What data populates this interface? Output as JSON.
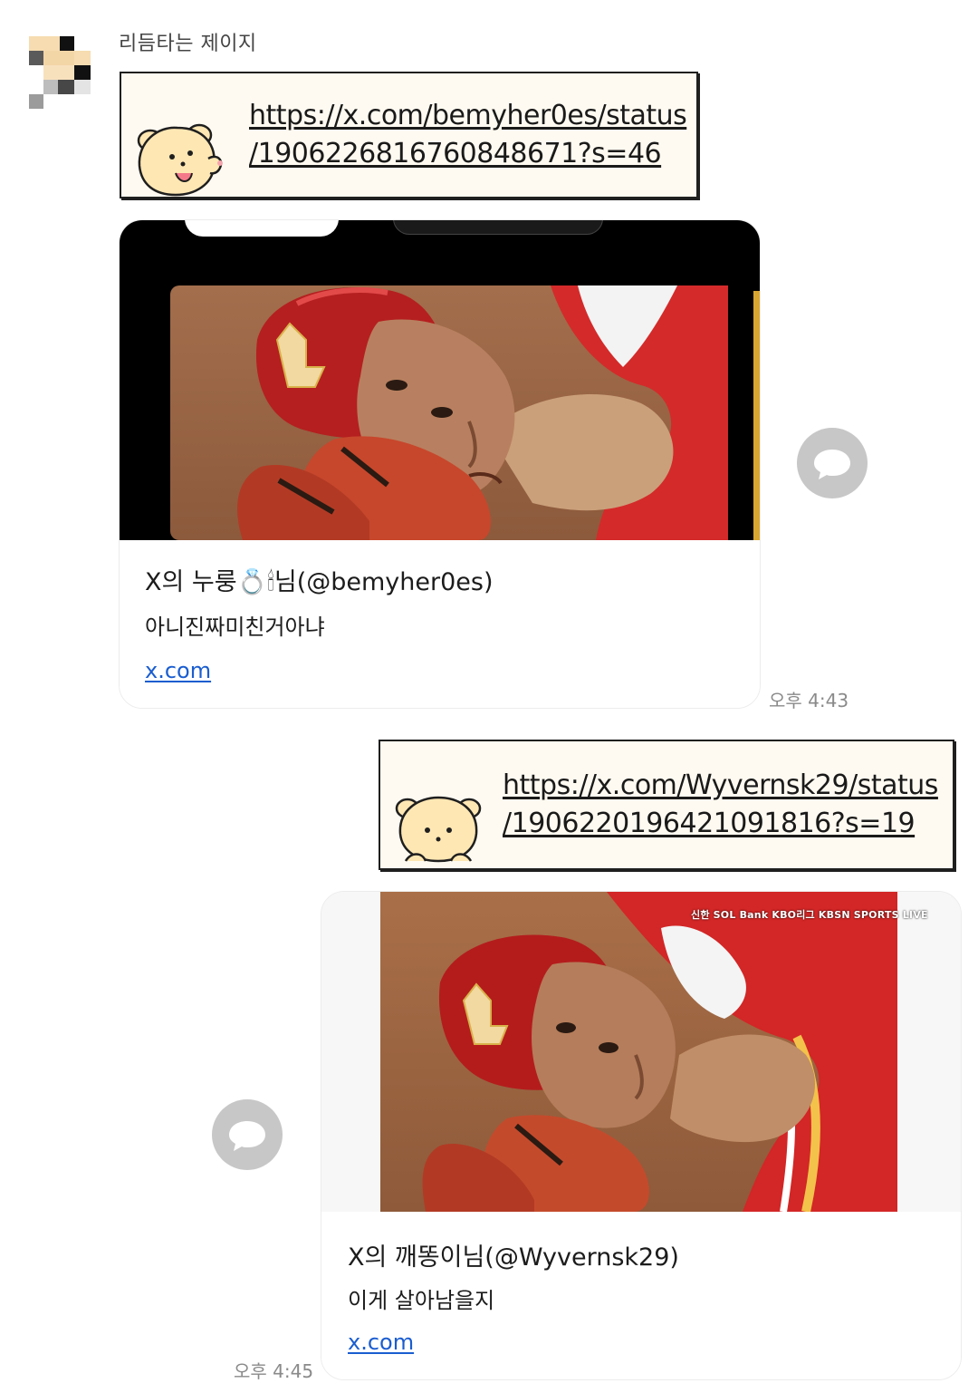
{
  "sender": {
    "name": "리듬타는 제이지"
  },
  "messages": [
    {
      "link": "https://x.com/bemyher0es/status/1906226816760848671?s=46",
      "link_line1": "https://x.com/bemyher0es/status",
      "link_line2": "/1906226816760848671?s=46",
      "preview": {
        "title": "X의 누룽💍🕯님(@bemyher0es)",
        "description": "아니진짜미친거아냐",
        "domain": "x.com"
      },
      "time": "오후 4:43"
    },
    {
      "link": "https://x.com/Wyvernsk29/status/1906220196421091816?s=19",
      "link_line1": "https://x.com/Wyvernsk29/status",
      "link_line2": "/1906220196421091816?s=19",
      "preview": {
        "title": "X의 깨똥이님(@Wyvernsk29)",
        "description": "이게 살아남을지",
        "domain": "x.com",
        "broadcast_logo": "신한 SOL Bank KBO리그 KBSN SPORTS LIVE"
      },
      "time": "오후 4:45"
    }
  ],
  "icons": {
    "share": "speech-bubble-icon",
    "sticker": "bear-icon"
  },
  "colors": {
    "link_blue": "#1a5dd0",
    "share_button": "#c7c7c7",
    "bubble_bg": "#fffaf1"
  }
}
